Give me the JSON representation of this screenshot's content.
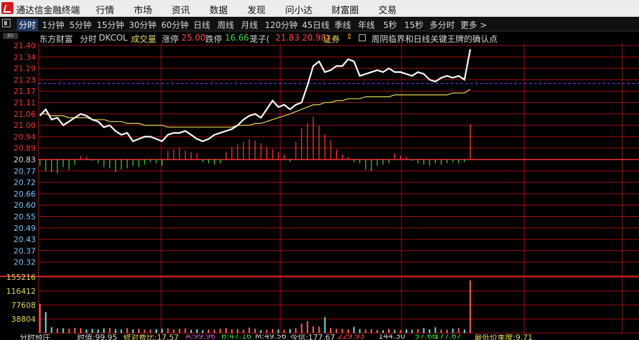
{
  "app": {
    "title": "通达信金融终端"
  },
  "menu": [
    "行情",
    "市场",
    "资讯",
    "数据",
    "发现",
    "问小达",
    "财富圈",
    "交易"
  ],
  "periods": [
    "分时",
    "1分钟",
    "5分钟",
    "15分钟",
    "30分钟",
    "60分钟",
    "日线",
    "周线",
    "月线",
    "120分钟",
    "45日线",
    "季线",
    "年线",
    "5秒",
    "15秒",
    "多分时",
    "更多 >"
  ],
  "active_period": "分时",
  "info": {
    "stock_name": "东方财富",
    "view": "分时",
    "indicator": "DKCOL",
    "vol_label": "成交量",
    "limit_up_label": "涨停",
    "limit_up": "25.00",
    "limit_down_label": "跌停",
    "limit_down": "16.66",
    "dragon_label": "茏子(",
    "dragon_values": "21.83 20.98)",
    "sector": "证券",
    "note": "周阴临界和日线关键王牌的确认点"
  },
  "bs_tag": "BS",
  "bottom_bar": [
    "分时预庄",
    "时值:99.95",
    "修对费比:17.57",
    "A:99.96",
    "B:47.16",
    "M:49.56",
    "今信:177.67",
    "229.93",
    "144.30",
    "57.66",
    "177.67",
    "最低价季度:9.71"
  ],
  "colors": {
    "up": "#ff3333",
    "down": "#33cc33",
    "grid": "#a01010",
    "price_line": "#ffffff",
    "avg_line": "#e8d85a",
    "neutral_label": "#7ec8ff"
  },
  "chart_data": {
    "type": "line",
    "price_axis": {
      "ticks": [
        21.4,
        21.34,
        21.29,
        21.23,
        21.17,
        21.11,
        21.06,
        21.0,
        20.94,
        20.89,
        20.83,
        20.77,
        20.72,
        20.66,
        20.6,
        20.55,
        20.49,
        20.43,
        20.37,
        20.32
      ],
      "tick_labels": [
        "21.40",
        "21.34",
        "21.29",
        "21.23",
        "21.17",
        "21.11",
        "21.06",
        "21.00",
        "20.94",
        "20.89",
        "20.83",
        "20.77",
        "20.72",
        "20.66",
        "20.60",
        "20.55",
        "20.49",
        "20.43",
        "20.37",
        "20.32"
      ],
      "prev_close": 20.83,
      "reference_dashed": 21.21
    },
    "volume_axis": {
      "tick_labels": [
        "155216",
        "116412",
        "77608",
        "38804"
      ],
      "ticks": [
        155216,
        116412,
        77608,
        38804
      ],
      "ylim": [
        0,
        155216
      ]
    },
    "price": [
      21.05,
      21.08,
      21.03,
      21.04,
      21.0,
      21.02,
      21.04,
      21.06,
      21.05,
      21.03,
      21.02,
      20.99,
      21.0,
      20.97,
      20.95,
      20.96,
      20.92,
      20.93,
      20.94,
      20.94,
      20.93,
      20.92,
      20.95,
      20.96,
      20.96,
      20.97,
      20.95,
      20.93,
      20.92,
      20.93,
      20.95,
      20.96,
      20.97,
      20.98,
      21.0,
      21.03,
      21.05,
      21.06,
      21.04,
      21.08,
      21.12,
      21.09,
      21.1,
      21.08,
      21.1,
      21.11,
      21.2,
      21.3,
      21.32,
      21.27,
      21.28,
      21.3,
      21.3,
      21.33,
      21.32,
      21.25,
      21.26,
      21.27,
      21.28,
      21.27,
      21.29,
      21.27,
      21.27,
      21.26,
      21.25,
      21.27,
      21.26,
      21.23,
      21.22,
      21.24,
      21.25,
      21.24,
      21.25,
      21.23,
      21.38
    ],
    "avg": [
      21.06,
      21.06,
      21.05,
      21.05,
      21.05,
      21.04,
      21.04,
      21.04,
      21.04,
      21.03,
      21.03,
      21.03,
      21.02,
      21.02,
      21.02,
      21.01,
      21.01,
      21.01,
      21.0,
      21.0,
      21.0,
      21.0,
      20.99,
      20.99,
      20.99,
      20.99,
      20.99,
      20.99,
      20.99,
      20.99,
      20.99,
      20.99,
      20.99,
      20.99,
      21.0,
      21.0,
      21.0,
      21.01,
      21.01,
      21.02,
      21.03,
      21.04,
      21.05,
      21.06,
      21.07,
      21.08,
      21.09,
      21.1,
      21.1,
      21.11,
      21.11,
      21.12,
      21.12,
      21.13,
      21.13,
      21.13,
      21.14,
      21.14,
      21.14,
      21.14,
      21.14,
      21.15,
      21.15,
      21.15,
      21.15,
      21.15,
      21.15,
      21.15,
      21.15,
      21.15,
      21.15,
      21.16,
      21.16,
      21.16,
      21.18
    ],
    "dkcol": [
      -0.5,
      -0.9,
      -1.0,
      -1.1,
      -0.6,
      -0.8,
      -0.4,
      0.3,
      0.2,
      -0.1,
      -0.3,
      -0.6,
      -0.7,
      -1.0,
      -0.8,
      -0.7,
      -0.5,
      -0.6,
      -0.4,
      -0.2,
      -0.3,
      -0.5,
      0.7,
      0.8,
      0.9,
      0.7,
      0.6,
      0.5,
      -0.2,
      -0.3,
      -0.4,
      -0.3,
      0.6,
      1.0,
      1.2,
      1.4,
      1.6,
      1.5,
      1.3,
      1.0,
      0.8,
      0.6,
      0.4,
      -0.2,
      1.4,
      2.5,
      2.9,
      3.4,
      2.7,
      2.0,
      1.5,
      0.8,
      0.4,
      0.2,
      -0.2,
      -0.3,
      -0.8,
      -0.9,
      -0.5,
      -0.4,
      -0.3,
      0.5,
      0.3,
      0.2,
      -0.1,
      -0.3,
      -0.4,
      -0.5,
      -0.3,
      -0.4,
      -0.3,
      -0.2,
      -0.3,
      -0.2,
      2.8
    ],
    "volume": [
      81000,
      58000,
      16000,
      13000,
      13000,
      12000,
      14000,
      13000,
      10000,
      12000,
      10000,
      13000,
      14000,
      11000,
      10000,
      14000,
      10000,
      12000,
      9500,
      10000,
      11000,
      12000,
      13000,
      10000,
      12000,
      13000,
      9000,
      11000,
      8000,
      10000,
      9000,
      12000,
      14000,
      10000,
      11000,
      9000,
      15000,
      12000,
      8000,
      9000,
      11000,
      10000,
      9000,
      11000,
      14000,
      26000,
      33000,
      19000,
      18000,
      44000,
      14000,
      12000,
      12000,
      10000,
      17000,
      11000,
      10000,
      11000,
      9000,
      8000,
      12000,
      9000,
      8000,
      10000,
      9000,
      11000,
      14000,
      10000,
      16000,
      10000,
      9000,
      12000,
      14000,
      10000,
      146000
    ]
  }
}
